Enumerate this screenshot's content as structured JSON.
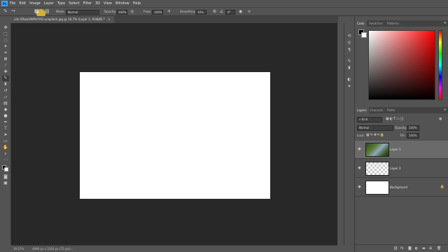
{
  "app": {
    "logo": "Ps"
  },
  "menu": [
    "File",
    "Edit",
    "Image",
    "Layer",
    "Type",
    "Select",
    "Filter",
    "3D",
    "View",
    "Window",
    "Help"
  ],
  "options": {
    "mode_label": "Mode:",
    "mode_value": "Normal",
    "opacity_label": "Opacity:",
    "opacity_value": "100%",
    "flow_label": "Flow:",
    "flow_value": "100%",
    "smoothing_label": "Smoothing:",
    "smoothing_value": "10%",
    "angle_value": "0°"
  },
  "document": {
    "tab_title": "cdc-5RwoUWPHYXQ-unsplash.jpg @ 16.7% (Layer 1, RGB/8) *"
  },
  "status": {
    "zoom": "16.67%",
    "size": "4896 px x 3264 px (72 ppi)"
  },
  "color_panel": {
    "tabs": [
      "Color",
      "Swatches",
      "Patterns"
    ]
  },
  "layers_panel": {
    "tabs": [
      "Layers",
      "Channels",
      "Paths"
    ],
    "kind": "Kind",
    "blend": "Normal",
    "opacity_label": "Opacity:",
    "opacity_value": "100%",
    "lock_label": "Lock:",
    "fill_label": "Fill:",
    "fill_value": "100%",
    "layers": [
      {
        "name": "Layer 1",
        "selected": true
      },
      {
        "name": "Layer 2",
        "selected": false
      },
      {
        "name": "Background",
        "selected": false
      }
    ]
  },
  "colors": {
    "accent": "#31a8ff",
    "canvas": "#ffffff",
    "workspace": "#282828",
    "panel": "#535353"
  }
}
